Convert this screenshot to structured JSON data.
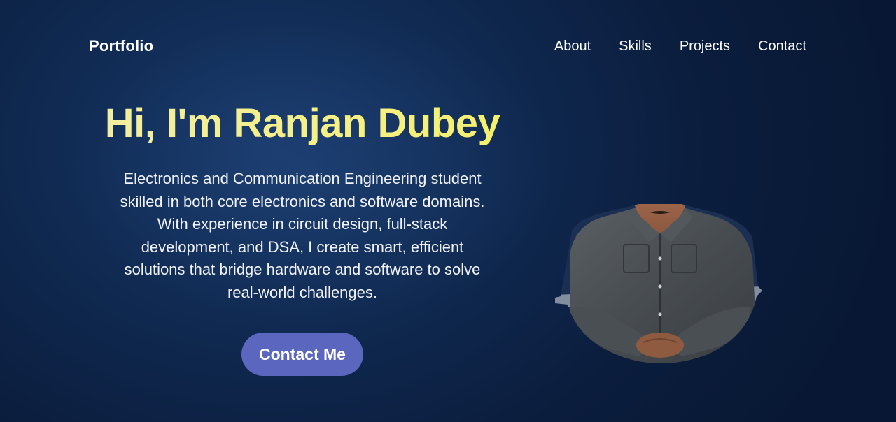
{
  "header": {
    "brand": "Portfolio",
    "nav": [
      {
        "label": "About"
      },
      {
        "label": "Skills"
      },
      {
        "label": "Projects"
      },
      {
        "label": "Contact"
      }
    ]
  },
  "hero": {
    "title": "Hi, I'm Ranjan Dubey",
    "description_lines": [
      "Electronics and Communication Engineering student",
      "skilled in both core electronics and software domains.",
      "With experience in circuit design, full-stack",
      "development, and DSA, I create smart, efficient",
      "solutions that bridge hardware and software to solve",
      "real-world challenges."
    ],
    "cta_label": "Contact Me"
  },
  "colors": {
    "background": "#0b1d3d",
    "title_accent": "#f5f09a",
    "button": "#5b66be",
    "text": "#ffffff"
  }
}
